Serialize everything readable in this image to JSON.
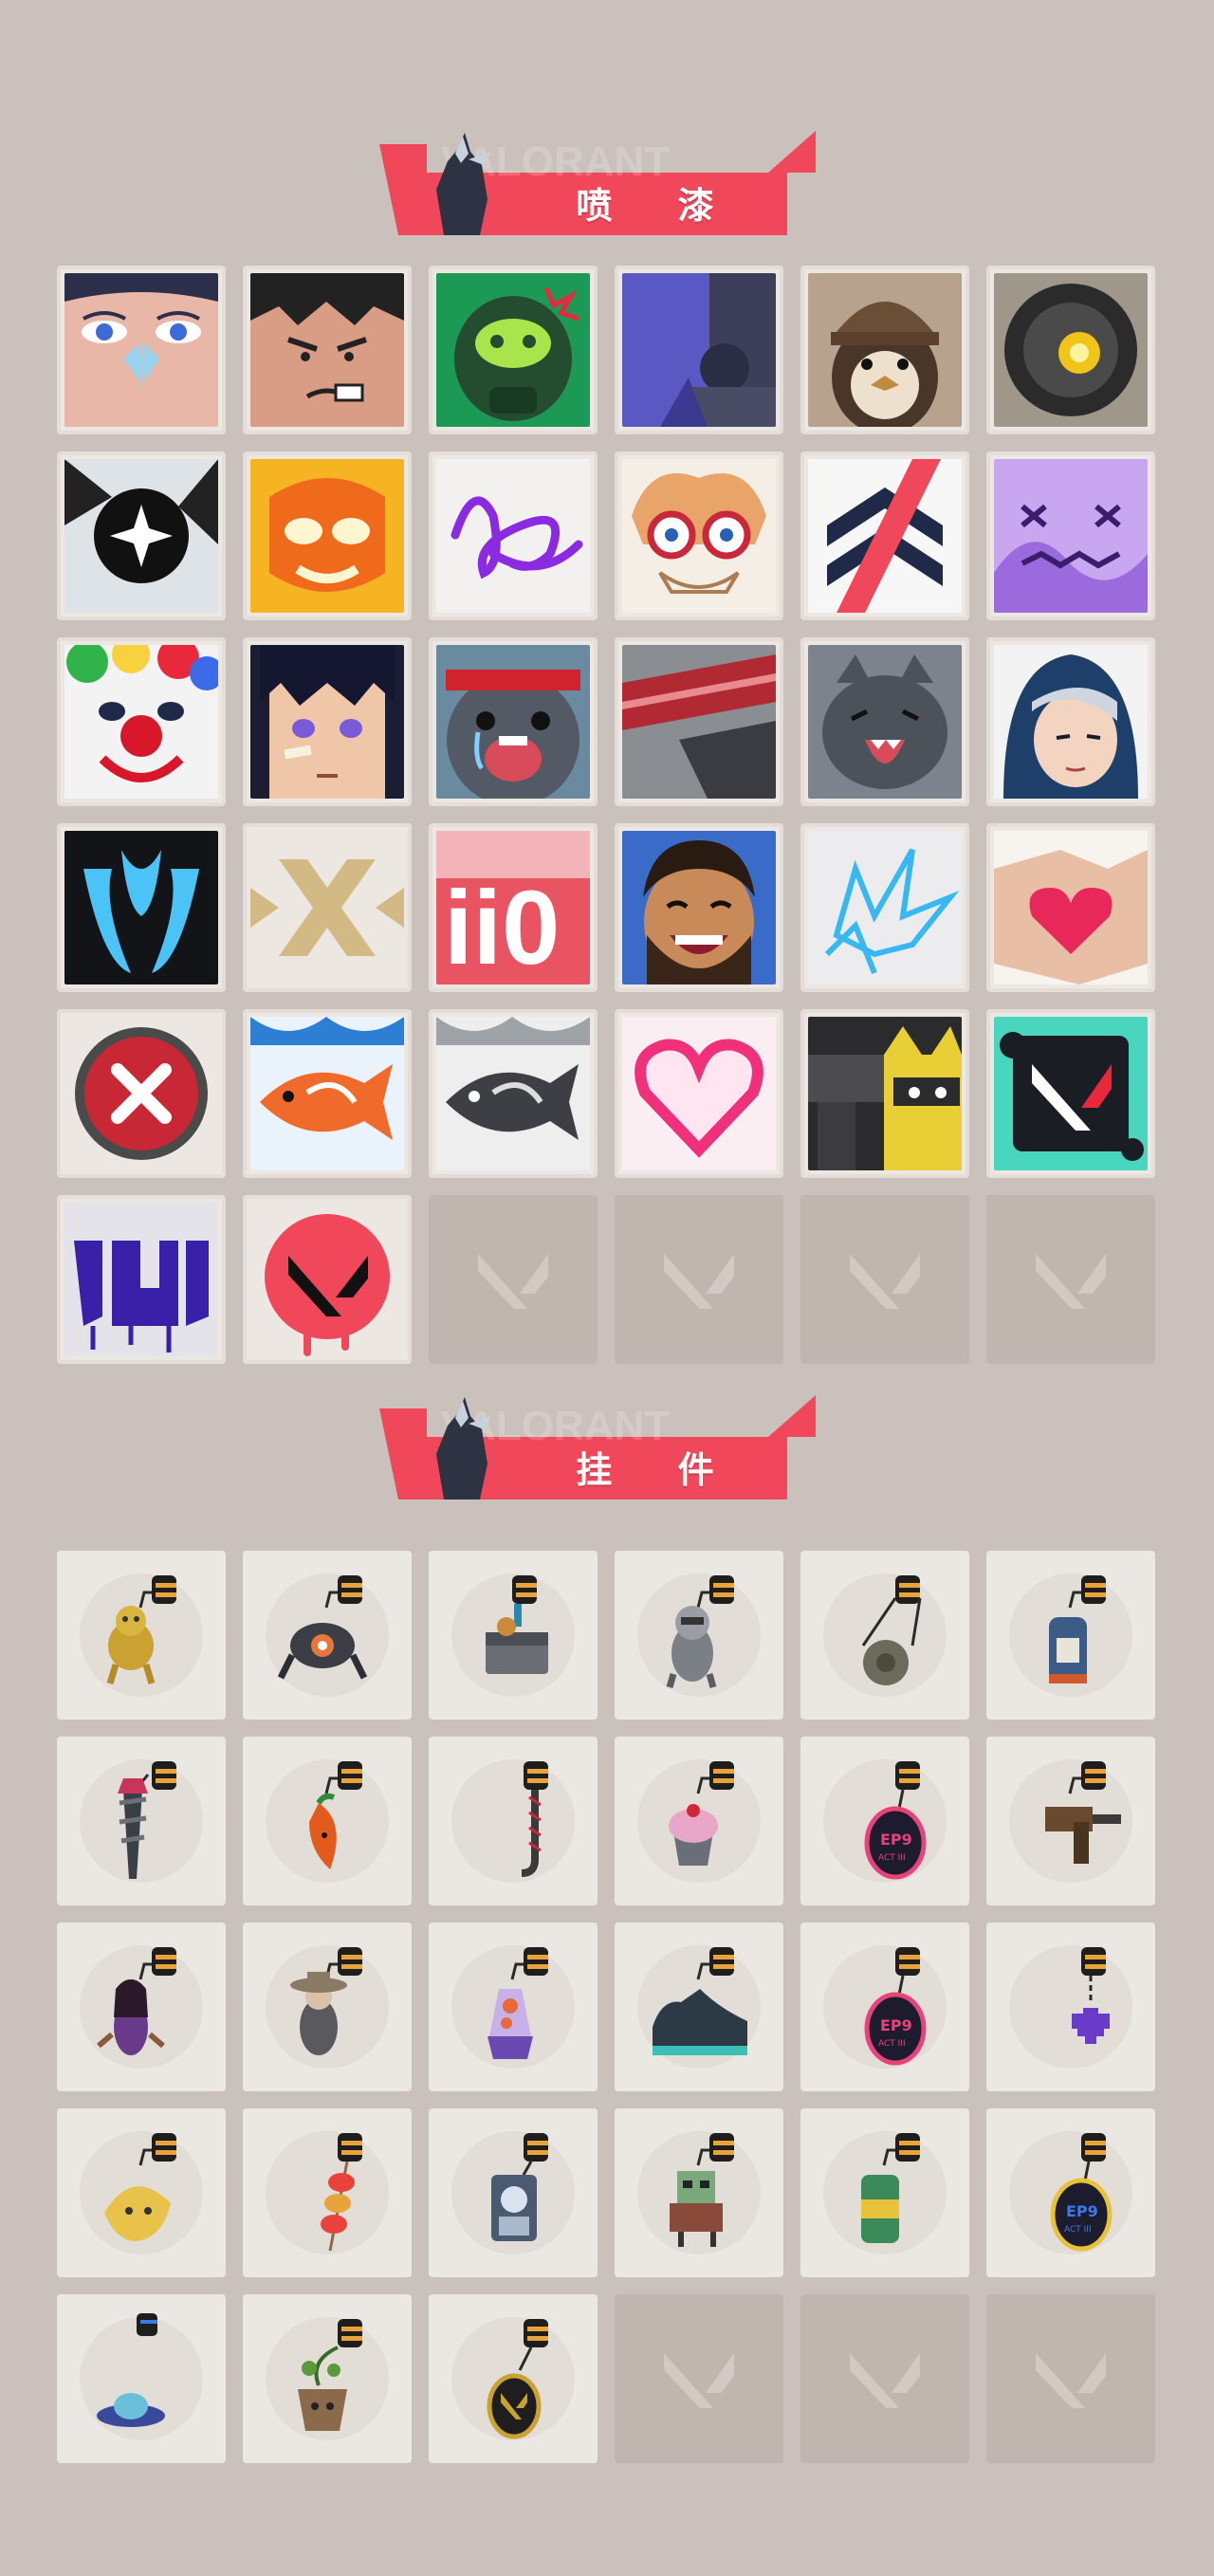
{
  "sections": [
    {
      "id": "sprays",
      "title": "喷 漆",
      "watermark": "VALORANT"
    },
    {
      "id": "buddies",
      "title": "挂 件",
      "watermark": "VALORANT"
    }
  ],
  "colors": {
    "background": "#cbc1bc",
    "accent": "#f0475a",
    "tile": "#ece7e3",
    "empty": "#c0b6b0"
  },
  "sprays": [
    {
      "name": "face-closeup-butterfly"
    },
    {
      "name": "angry-boy"
    },
    {
      "name": "green-mask-angry"
    },
    {
      "name": "purple-robot"
    },
    {
      "name": "penguin-beanie"
    },
    {
      "name": "sentinel-camera"
    },
    {
      "name": "black-star-circle"
    },
    {
      "name": "orange-lion-mask"
    },
    {
      "name": "purple-signature"
    },
    {
      "name": "glasses-old-man"
    },
    {
      "name": "navy-chevrons"
    },
    {
      "name": "purple-dizzy-face"
    },
    {
      "name": "clown-face"
    },
    {
      "name": "anime-boy-bandage"
    },
    {
      "name": "crying-blob-headband"
    },
    {
      "name": "bacon-strip"
    },
    {
      "name": "grey-cat-laugh"
    },
    {
      "name": "hooded-agent"
    },
    {
      "name": "blue-flame-mask"
    },
    {
      "name": "gold-cross-logo"
    },
    {
      "name": "number-two-zero"
    },
    {
      "name": "bearded-laugh"
    },
    {
      "name": "neon-blue-stars"
    },
    {
      "name": "hands-heart"
    },
    {
      "name": "red-cross-button"
    },
    {
      "name": "orange-koi"
    },
    {
      "name": "grey-koi"
    },
    {
      "name": "neon-pink-heart"
    },
    {
      "name": "pistol-cat"
    },
    {
      "name": "teal-splash-logo"
    },
    {
      "name": "purple-graffiti"
    },
    {
      "name": "red-logo-drip"
    },
    {
      "name": "empty"
    },
    {
      "name": "empty"
    },
    {
      "name": "empty"
    },
    {
      "name": "empty"
    }
  ],
  "buddies": [
    {
      "name": "gold-creature"
    },
    {
      "name": "robot-drone"
    },
    {
      "name": "treasure-chest"
    },
    {
      "name": "raccoon-figure"
    },
    {
      "name": "round-bag"
    },
    {
      "name": "canister"
    },
    {
      "name": "spiked-mace"
    },
    {
      "name": "chili-pepper"
    },
    {
      "name": "braided-rope"
    },
    {
      "name": "cupcake"
    },
    {
      "name": "ep9-medal-pink"
    },
    {
      "name": "wooden-gun"
    },
    {
      "name": "female-agent"
    },
    {
      "name": "cowboy-agent"
    },
    {
      "name": "lava-lamp"
    },
    {
      "name": "sneaker"
    },
    {
      "name": "ep9-medal-pink"
    },
    {
      "name": "pixel-heart"
    },
    {
      "name": "banana-peel"
    },
    {
      "name": "fruit-skewer"
    },
    {
      "name": "agent-card"
    },
    {
      "name": "toolbox-robot"
    },
    {
      "name": "soda-can"
    },
    {
      "name": "ep9-medal-blue"
    },
    {
      "name": "ufo"
    },
    {
      "name": "potted-plant"
    },
    {
      "name": "logo-coin"
    },
    {
      "name": "empty"
    },
    {
      "name": "empty"
    },
    {
      "name": "empty"
    }
  ]
}
